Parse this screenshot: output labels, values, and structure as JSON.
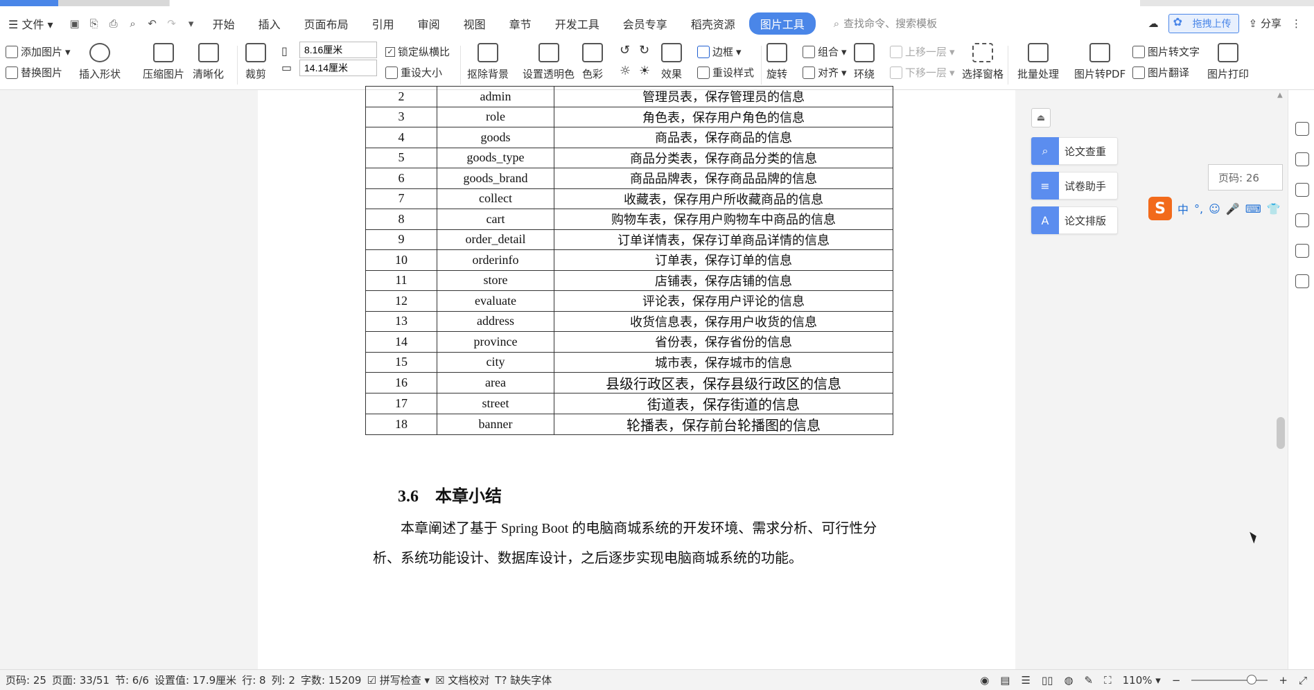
{
  "menubar": {
    "file_label": "文件",
    "tabs": [
      "开始",
      "插入",
      "页面布局",
      "引用",
      "审阅",
      "视图",
      "章节",
      "开发工具",
      "会员专享",
      "稻壳资源"
    ],
    "active_tab": "图片工具",
    "search_placeholder": "查找命令、搜索模板",
    "upload_label": "拖拽上传",
    "share_label": "分享"
  },
  "ribbon": {
    "add_picture": "添加图片",
    "replace_picture": "替换图片",
    "insert_shape": "插入形状",
    "compress_picture": "压缩图片",
    "sharpen": "清晰化",
    "crop": "裁剪",
    "width_value": "8.16厘米",
    "height_value": "14.14厘米",
    "lock_ratio": "锁定纵横比",
    "reset_size": "重设大小",
    "remove_bg": "抠除背景",
    "set_transparent": "设置透明色",
    "color": "色彩",
    "effects": "效果",
    "border": "边框",
    "reset_style": "重设样式",
    "rotate": "旋转",
    "group": "组合",
    "align": "对齐",
    "wrap": "环绕",
    "bring_forward": "上移一层",
    "send_backward": "下移一层",
    "selection_pane": "选择窗格",
    "batch": "批量处理",
    "to_pdf": "图片转PDF",
    "to_text": "图片转文字",
    "translate": "图片翻译",
    "print": "图片打印"
  },
  "table": {
    "rows": [
      [
        "2",
        "admin",
        "管理员表，保存管理员的信息"
      ],
      [
        "3",
        "role",
        "角色表，保存用户角色的信息"
      ],
      [
        "4",
        "goods",
        "商品表，保存商品的信息"
      ],
      [
        "5",
        "goods_type",
        "商品分类表，保存商品分类的信息"
      ],
      [
        "6",
        "goods_brand",
        "商品品牌表，保存商品品牌的信息"
      ],
      [
        "7",
        "collect",
        "收藏表，保存用户所收藏商品的信息"
      ],
      [
        "8",
        "cart",
        "购物车表，保存用户购物车中商品的信息"
      ],
      [
        "9",
        "order_detail",
        "订单详情表，保存订单商品详情的信息"
      ],
      [
        "10",
        "orderinfo",
        "订单表，保存订单的信息"
      ],
      [
        "11",
        "store",
        "店铺表，保存店铺的信息"
      ],
      [
        "12",
        "evaluate",
        "评论表，保存用户评论的信息"
      ],
      [
        "13",
        "address",
        "收货信息表，保存用户收货的信息"
      ],
      [
        "14",
        "province",
        "省份表，保存省份的信息"
      ],
      [
        "15",
        "city",
        "城市表，保存城市的信息"
      ],
      [
        "16",
        "area",
        "县级行政区表，保存县级行政区的信息"
      ],
      [
        "17",
        "street",
        "街道表，保存街道的信息"
      ],
      [
        "18",
        "banner",
        "轮播表，保存前台轮播图的信息"
      ]
    ]
  },
  "section": {
    "heading": "3.6　本章小结",
    "paragraph": "本章阐述了基于 Spring Boot 的电脑商城系统的开发环境、需求分析、可行性分析、系统功能设计、数据库设计，之后逐步实现电脑商城系统的功能。"
  },
  "side_panel": {
    "tools": [
      "论文查重",
      "试卷助手",
      "论文排版"
    ],
    "page_badge": "页码: 26",
    "ime_label": "中"
  },
  "statusbar": {
    "page_num": "页码: 25",
    "page_count": "页面: 33/51",
    "section": "节: 6/6",
    "setting": "设置值: 17.9厘米",
    "row": "行: 8",
    "col": "列: 2",
    "word_count": "字数: 15209",
    "spell": "拼写检查",
    "proof": "文档校对",
    "missing_font": "缺失字体",
    "zoom": "110%"
  }
}
